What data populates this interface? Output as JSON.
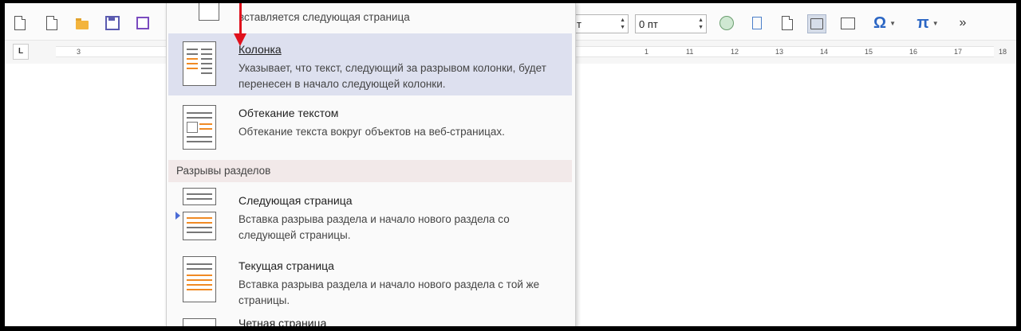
{
  "toolbar": {
    "spacing_value": "0 пт",
    "spacing_fragment": "т",
    "omega_symbol": "Ω",
    "pi_symbol": "π",
    "more_symbol": "»"
  },
  "ruler": {
    "tab_marker": "L",
    "numbers": [
      "3",
      "1",
      "11",
      "12",
      "13",
      "14",
      "15",
      "16",
      "17",
      "18"
    ]
  },
  "menu": {
    "top_fragment": "вставляется следующая страница",
    "column_break": {
      "title": "Колонка",
      "description": "Указывает, что текст, следующий за разрывом колонки, будет перенесен в начало следующей колонки."
    },
    "text_wrapping": {
      "title": "Обтекание текстом",
      "description": "Обтекание текста вокруг объектов на веб-страницах."
    },
    "section_header": "Разрывы разделов",
    "next_page": {
      "title": "Следующая страница",
      "description": "Вставка разрыва раздела и начало нового раздела со следующей страницы."
    },
    "continuous": {
      "title": "Текущая страница",
      "description": "Вставка разрыва раздела и начало нового раздела с той же страницы."
    },
    "even_page": {
      "title": "Четная страница"
    }
  },
  "colors": {
    "arrow": "#e0101c",
    "highlight": "#dde0ef",
    "section_header_bg": "#f2e9e9",
    "icon_accent": "#f08a24"
  }
}
